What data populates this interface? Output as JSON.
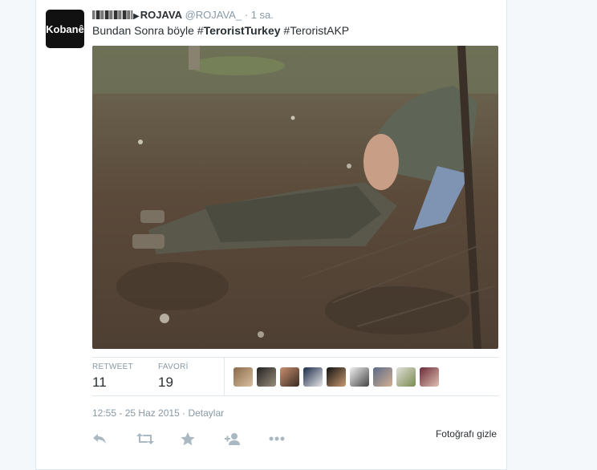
{
  "tweet": {
    "avatar_text": "Kobanê",
    "name": "ROJAVA",
    "handle": "@ROJAVA_",
    "separator": "·",
    "time": "1 sa.",
    "text_plain": "Bundan Sonra böyle",
    "hashtags": [
      {
        "hash": "#",
        "word": "TeroristTurkey",
        "bold": true
      },
      {
        "hash": "#",
        "word": "TeroristAKP",
        "bold": false
      }
    ],
    "photo_icon": "photo-outdoor-scene"
  },
  "stats": {
    "retweet_label": "RETWEET",
    "retweet_count": "11",
    "favorite_label": "FAVORİ",
    "favorite_count": "19",
    "favoriter_avatar_count": 9
  },
  "timestamp": {
    "date": "12:55 - 25 Haz 2015",
    "separator": "·",
    "details": "Detaylar"
  },
  "actions": {
    "icons": [
      "reply-icon",
      "retweet-icon",
      "favorite-star-icon",
      "follow-user-icon",
      "more-dots-icon"
    ],
    "hide_photo": "Fotoğrafı gizle"
  },
  "colors": {
    "link_gray": "#8899a6",
    "text": "#292f33",
    "border": "#e1e8ed"
  }
}
